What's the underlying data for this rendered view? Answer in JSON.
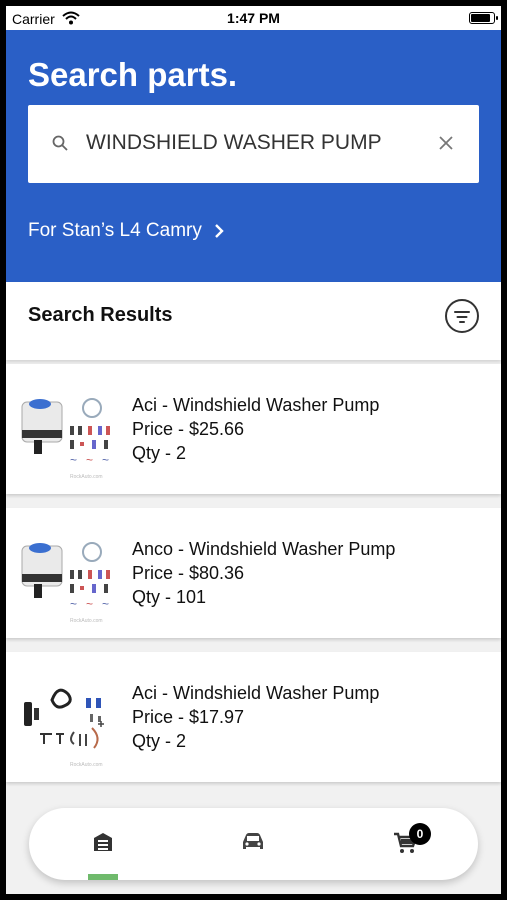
{
  "status_bar": {
    "carrier": "Carrier",
    "time": "1:47 PM",
    "battery_level": 0.92
  },
  "header": {
    "title": "Search parts.",
    "search_value": "WINDSHIELD WASHER PUMP",
    "vehicle_link": "For Stan’s L4 Camry"
  },
  "results": {
    "title": "Search Results",
    "items": [
      {
        "name": "Aci - Windshield Washer Pump",
        "price": "Price - $25.66",
        "qty": "Qty - 2",
        "watermark": "RockAuto.com"
      },
      {
        "name": "Anco - Windshield Washer Pump",
        "price": "Price - $80.36",
        "qty": "Qty - 101",
        "watermark": "RockAuto.com"
      },
      {
        "name": "Aci - Windshield Washer Pump",
        "price": "Price - $17.97",
        "qty": "Qty - 2",
        "watermark": "RockAuto.com"
      }
    ]
  },
  "bottom_nav": {
    "items": [
      {
        "icon": "parts-store-icon",
        "active": true
      },
      {
        "icon": "car-icon",
        "active": false
      },
      {
        "icon": "cart-icon",
        "active": false
      }
    ],
    "cart_count": "0",
    "active_color": "#6fba6c"
  },
  "colors": {
    "header_bg": "#2a5fc6",
    "screen_bg": "#f1f1f1"
  }
}
